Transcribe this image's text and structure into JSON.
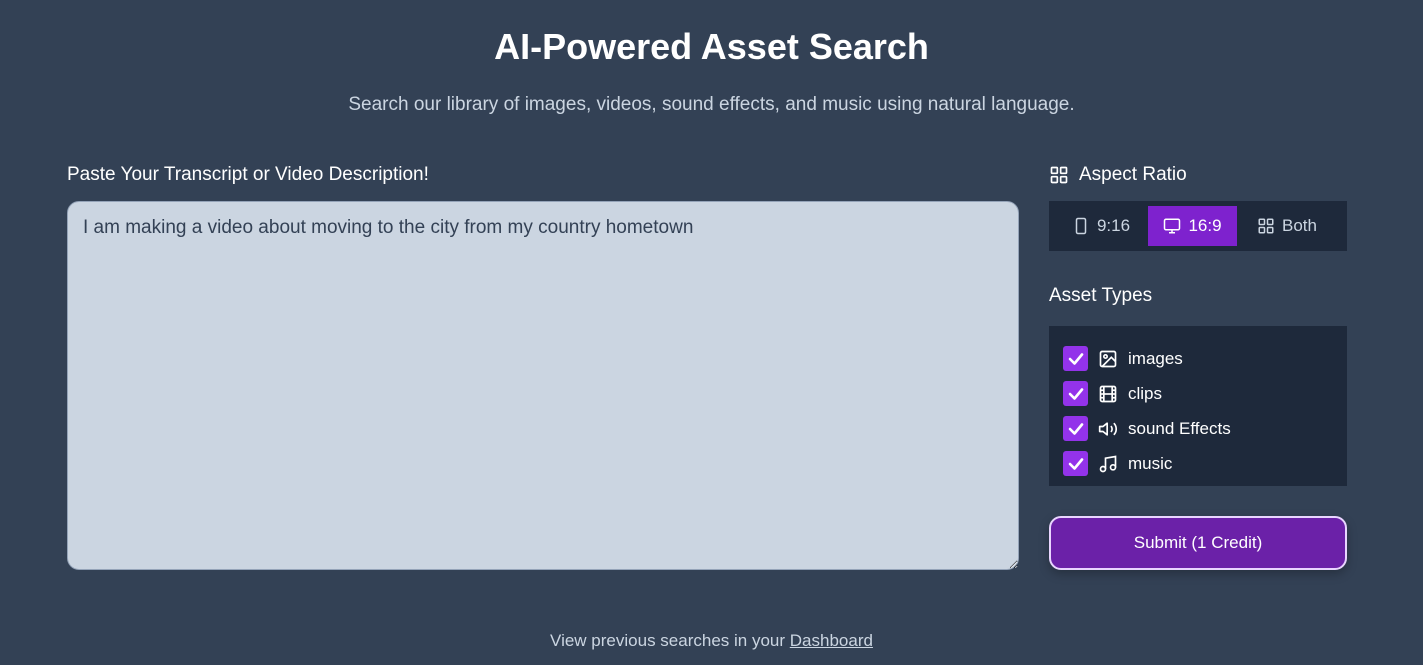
{
  "header": {
    "title": "AI-Powered Asset Search",
    "subtitle": "Search our library of images, videos, sound effects, and music using natural language."
  },
  "transcript": {
    "label": "Paste Your Transcript or Video Description!",
    "value": "I am making a video about moving to the city from my country hometown"
  },
  "aspect_ratio": {
    "heading": "Aspect Ratio",
    "heading_icon": "grid-icon",
    "options": [
      {
        "label": "9:16",
        "icon": "phone-icon",
        "selected": false
      },
      {
        "label": "16:9",
        "icon": "monitor-icon",
        "selected": true
      },
      {
        "label": "Both",
        "icon": "grid-icon",
        "selected": false
      }
    ]
  },
  "asset_types": {
    "heading": "Asset Types",
    "items": [
      {
        "label": "images",
        "icon": "image-icon",
        "checked": true
      },
      {
        "label": "clips",
        "icon": "film-icon",
        "checked": true
      },
      {
        "label": "sound Effects",
        "icon": "speaker-icon",
        "checked": true
      },
      {
        "label": "music",
        "icon": "music-note-icon",
        "checked": true
      }
    ]
  },
  "submit": {
    "label": "Submit (1 Credit)"
  },
  "footer": {
    "text": "View previous searches in your",
    "link": "Dashboard"
  },
  "colors": {
    "background": "#334155",
    "accent": "#7e22ce",
    "panel": "#1e293b",
    "checkbox": "#9333ea"
  }
}
